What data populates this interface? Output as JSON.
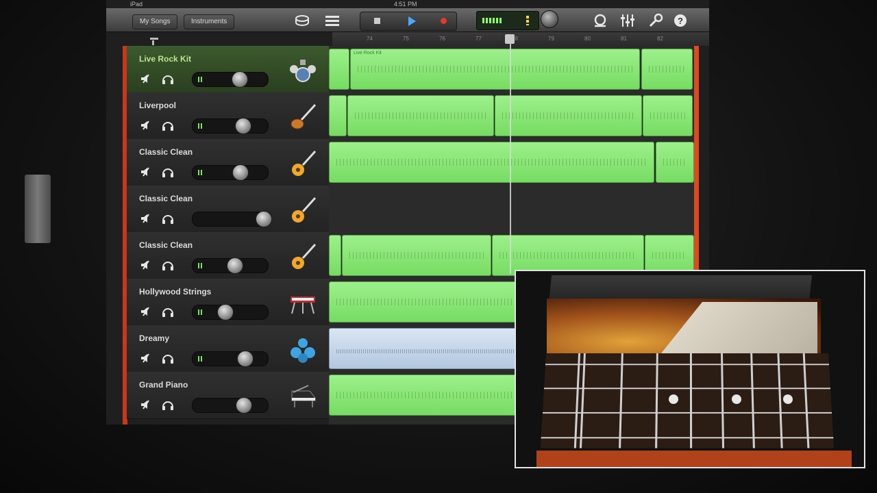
{
  "status": {
    "device": "iPad",
    "time": "4:51 PM"
  },
  "toolbar": {
    "my_songs_label": "My Songs",
    "instruments_label": "Instruments",
    "icons": [
      "track-view-icon",
      "tracks-list-icon",
      "stop-icon",
      "play-icon",
      "record-icon",
      "loop-icon",
      "mixer-icon",
      "settings-icon",
      "help-icon"
    ]
  },
  "ruler": {
    "bars": [
      "",
      "74",
      "75",
      "76",
      "77",
      "78",
      "79",
      "80",
      "81",
      "82"
    ]
  },
  "tracks": [
    {
      "name": "Live Rock Kit",
      "instrument_icon": "drum-kit-icon",
      "selected": true
    },
    {
      "name": "Liverpool",
      "instrument_icon": "bass-guitar-icon",
      "selected": false
    },
    {
      "name": "Classic Clean",
      "instrument_icon": "guitar-icon",
      "selected": false
    },
    {
      "name": "Classic Clean",
      "instrument_icon": "guitar-icon",
      "selected": false
    },
    {
      "name": "Classic Clean",
      "instrument_icon": "guitar-icon",
      "selected": false
    },
    {
      "name": "Hollywood Strings",
      "instrument_icon": "keyboard-icon",
      "selected": false
    },
    {
      "name": "Dreamy",
      "instrument_icon": "synth-icon",
      "selected": false
    },
    {
      "name": "Grand Piano",
      "instrument_icon": "grand-piano-icon",
      "selected": false
    }
  ],
  "regions": [
    {
      "track": 0,
      "label": "Live Rock Kit"
    },
    {
      "track": 1,
      "label": ""
    },
    {
      "track": 2,
      "label": ""
    },
    {
      "track": 4,
      "label": ""
    },
    {
      "track": 5,
      "label": ""
    },
    {
      "track": 6,
      "label": ""
    },
    {
      "track": 7,
      "label": ""
    }
  ],
  "colors": {
    "region_green": "#8ee77a",
    "audio_region_blue": "#c6d6ea",
    "accent_orange": "#e0481f",
    "play_blue": "#4aa8ff"
  }
}
